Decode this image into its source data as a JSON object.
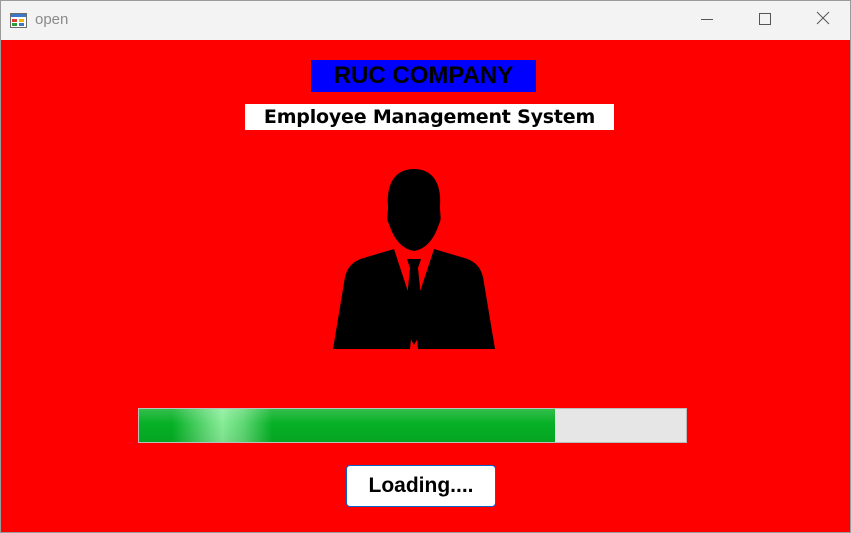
{
  "window": {
    "title": "open",
    "icons": {
      "app": "form-app-icon",
      "minimize": "minimize-icon",
      "maximize": "maximize-icon",
      "close": "close-icon"
    }
  },
  "main": {
    "company_name": "RUC COMPANY",
    "system_name": "Employee Management System",
    "employee_icon": "employee-silhouette-icon",
    "progress": {
      "value_fraction": 0.76
    },
    "loading_label": "Loading....",
    "colors": {
      "background": "#ff0000",
      "company_label_bg": "#0000ff",
      "system_label_bg": "#ffffff",
      "progress_fill": "#06b025",
      "progress_track": "#e6e6e6",
      "button_border": "#0a63c9"
    }
  }
}
